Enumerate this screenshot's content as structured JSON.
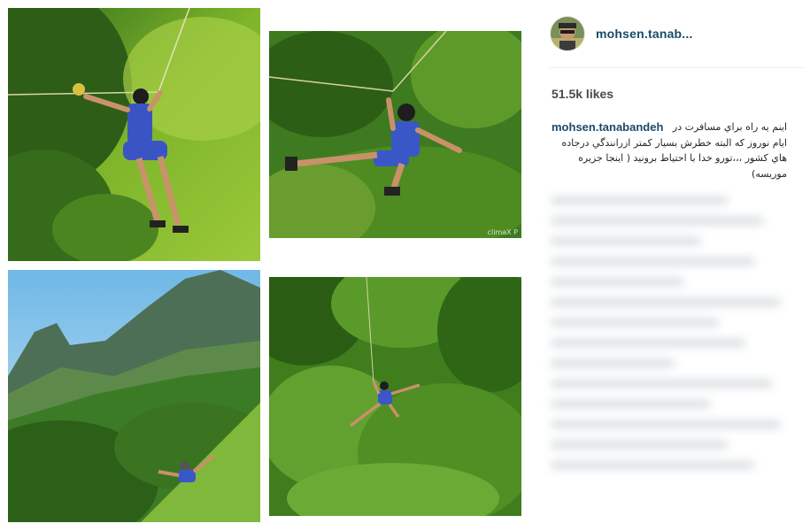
{
  "post": {
    "username": "mohsen.tanab...",
    "likes": "51.5k likes",
    "caption_user": "mohsen.tanabandeh",
    "caption_text": "اینم یه راه براي مسافرت در ایام نوروز که البته خطرش بسیار کمتر ازرانندگي درجاده هاي کشور ،،،تورو خدا با احتیاط برونید ( اینجا جزیره موریسه)"
  },
  "photos": {
    "p2_watermark": "climaX P"
  },
  "colors": {
    "username": "#1a4a6b",
    "likes": "#4a4a4a",
    "divider": "#efefef"
  },
  "icons": {
    "avatar": "profile-avatar"
  }
}
